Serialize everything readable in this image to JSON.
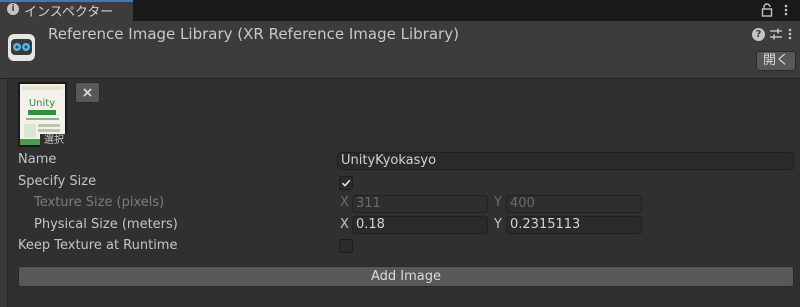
{
  "tab": {
    "label": "インスペクター"
  },
  "header": {
    "title": "Reference Image Library (XR Reference Image Library)",
    "open_label": "開く"
  },
  "image_entry": {
    "thumbnail_text": "Unity",
    "select_label": "選択",
    "name_label": "Name",
    "name_value": "UnityKyokasyo",
    "specify_size_label": "Specify Size",
    "specify_size_checked": true,
    "texture_size_label": "Texture Size (pixels)",
    "texture_x_axis": "X",
    "texture_x": "311",
    "texture_y_axis": "Y",
    "texture_y": "400",
    "physical_size_label": "Physical Size (meters)",
    "physical_x_axis": "X",
    "physical_x": "0.18",
    "physical_y_axis": "Y",
    "physical_y": "0.2315113",
    "keep_texture_label": "Keep Texture at Runtime",
    "keep_texture_checked": false
  },
  "add_image_label": "Add Image",
  "colors": {
    "accent": "#3a79bb",
    "background": "#383838",
    "panel": "#303030"
  }
}
